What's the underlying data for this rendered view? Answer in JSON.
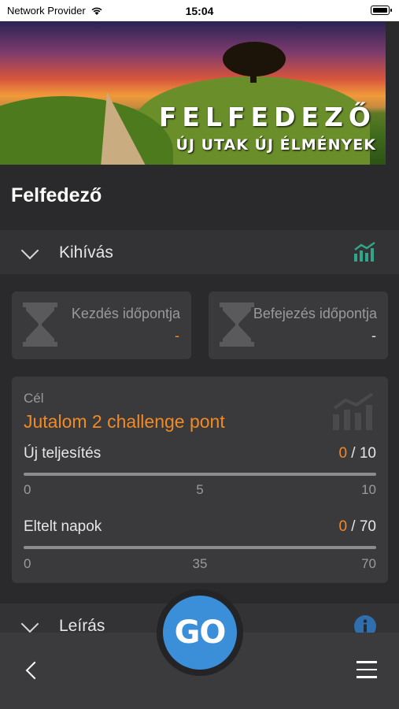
{
  "status_bar": {
    "carrier": "Network Provider",
    "time": "15:04"
  },
  "hero": {
    "title": "FELFEDEZŐ",
    "subtitle": "ÚJ UTAK ÚJ ÉLMÉNYEK"
  },
  "page_title": "Felfedező",
  "challenge_section": {
    "label": "Kihívás",
    "icon": "bar-chart-icon",
    "icon_color": "#2fa58a"
  },
  "dates": {
    "start": {
      "label": "Kezdés időpontja",
      "value": "-",
      "value_color": "#f08a24"
    },
    "end": {
      "label": "Befejezés időpontja",
      "value": "-",
      "value_color": "#e6e6e6"
    }
  },
  "goal": {
    "label": "Cél",
    "reward": "Jutalom 2 challenge pont",
    "new_completion": {
      "label": "Új teljesítés",
      "current": "0",
      "separator": " / ",
      "target": "10",
      "ticks": [
        "0",
        "5",
        "10"
      ],
      "progress": 0
    },
    "elapsed_days": {
      "label": "Eltelt napok",
      "current": "0",
      "separator": " / ",
      "target": "70",
      "ticks": [
        "0",
        "35",
        "70"
      ],
      "progress": 0
    }
  },
  "description_section": {
    "label": "Leírás",
    "icon": "info-icon",
    "icon_color": "#2f6fb0"
  },
  "go_button": {
    "label": "GO",
    "color": "#3a8fd8"
  },
  "nav": {
    "back_icon": "chevron-left-icon",
    "menu_icon": "hamburger-menu-icon"
  }
}
